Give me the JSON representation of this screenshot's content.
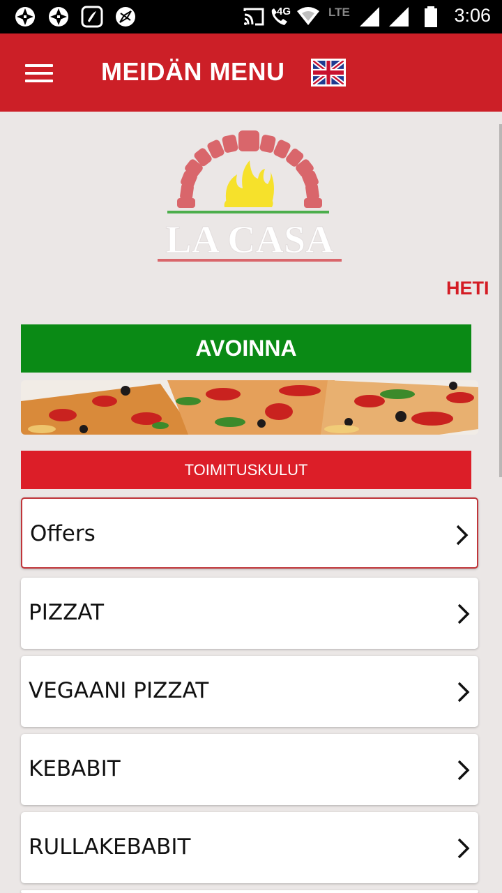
{
  "status_bar": {
    "time": "3:06",
    "network_label": "4G",
    "lte_label": "LTE",
    "icons": [
      "aperture-icon",
      "aperture-icon",
      "saavn-icon",
      "compass-icon",
      "cast-icon",
      "wifi-call-icon",
      "wifi-icon",
      "signal-icon",
      "signal-icon",
      "battery-icon"
    ]
  },
  "appbar": {
    "title": "MEIDÄN MENU",
    "menu_icon": "hamburger-menu-icon",
    "language_icon": "uk-flag-icon"
  },
  "logo": {
    "text": "LA CASA"
  },
  "marquee": {
    "text": "HETI"
  },
  "status": {
    "open_label": "AVOINNA",
    "color": "#0a8a15"
  },
  "delivery": {
    "label": "TOIMITUSKULUT"
  },
  "categories": [
    {
      "label": "Offers"
    },
    {
      "label": "PIZZAT"
    },
    {
      "label": "VEGAANI PIZZAT"
    },
    {
      "label": "KEBABIT"
    },
    {
      "label": "RULLAKEBABIT"
    }
  ],
  "colors": {
    "brand_red": "#cc1f27",
    "background": "#ebe7e6",
    "accent_green": "#0a8a15"
  }
}
